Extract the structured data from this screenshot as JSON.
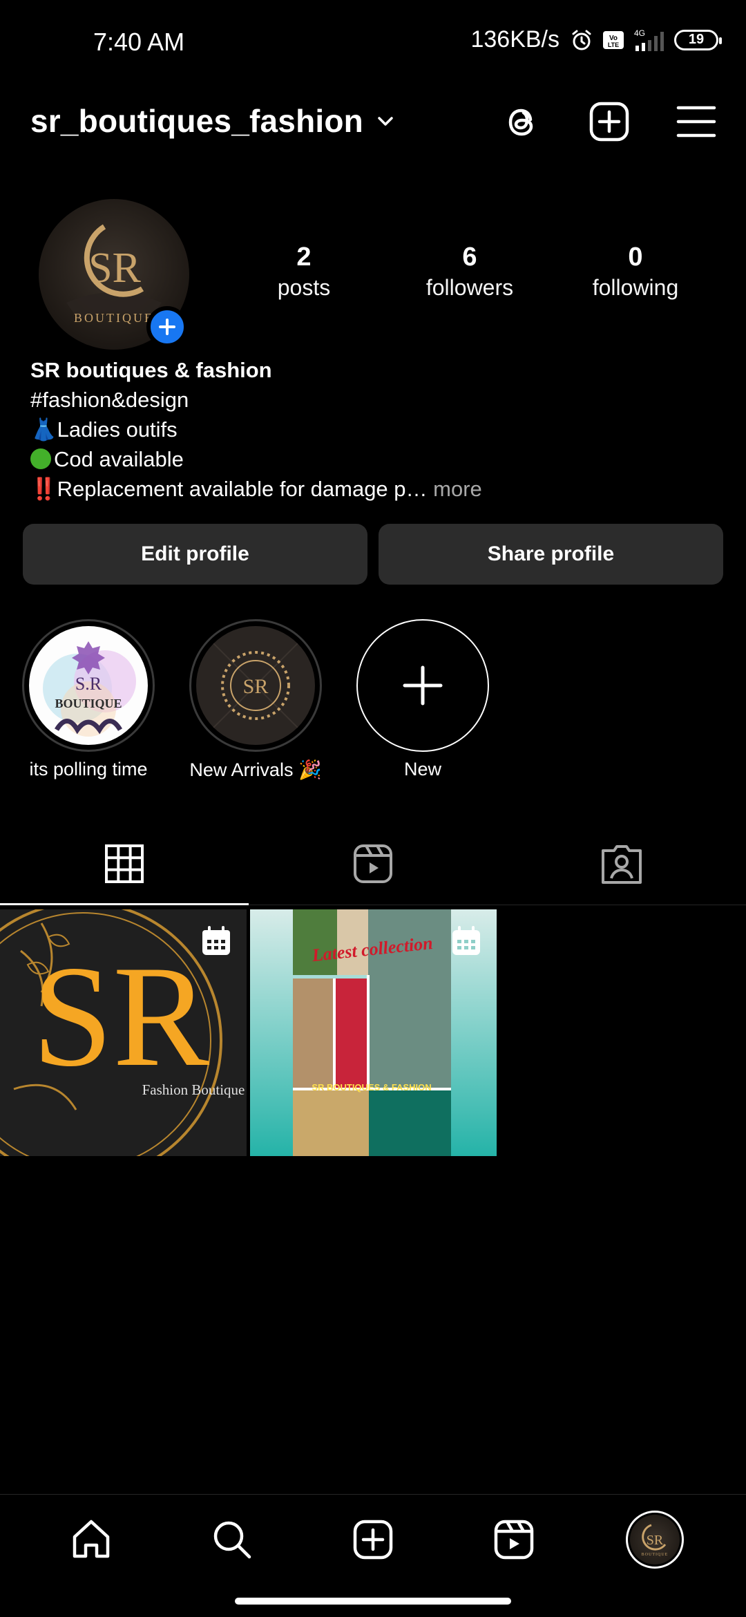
{
  "status_bar": {
    "time": "7:40 AM",
    "network_speed": "136KB/s",
    "network_type": "4G",
    "battery": "19",
    "icons": [
      "alarm-icon",
      "volte-icon",
      "signal-icon",
      "battery-icon"
    ]
  },
  "header": {
    "username": "sr_boutiques_fashion",
    "icons": [
      "chevron-down-icon",
      "threads-icon",
      "create-post-icon",
      "menu-icon"
    ]
  },
  "profile": {
    "avatar_text": "SR",
    "avatar_subtext": "BOUTIQUE",
    "stats": [
      {
        "value": "2",
        "label": "posts"
      },
      {
        "value": "6",
        "label": "followers"
      },
      {
        "value": "0",
        "label": "following"
      }
    ],
    "bio": {
      "name": "SR boutiques & fashion",
      "line1": "#fashion&design",
      "line2": "Ladies outifs",
      "line3": "Cod available",
      "line4": "Replacement available for damage p…",
      "more": "more",
      "emoji_dress": "👗",
      "emoji_alert": "‼️"
    }
  },
  "buttons": {
    "edit": "Edit profile",
    "share": "Share profile"
  },
  "highlights": [
    {
      "label": "its polling time",
      "image_text": "S.R",
      "image_subtext": "BOUTIQUE"
    },
    {
      "label": "New Arrivals 🎉",
      "image_text": "SR"
    },
    {
      "label": "New"
    }
  ],
  "tabs": [
    "grid-icon",
    "reels-icon",
    "tagged-icon"
  ],
  "posts": [
    {
      "title": "SR",
      "subtitle": "Fashion Boutique",
      "accent": "#f5a623"
    },
    {
      "title": "Latest collection",
      "subtitle": "SR BOUTIQUES & FASHION",
      "accent": "#2bb5ad"
    }
  ],
  "bottom_nav": [
    "home-icon",
    "search-icon",
    "create-icon",
    "reels-icon",
    "profile-avatar"
  ],
  "colors": {
    "background": "#000000",
    "button_bg": "#2c2c2c",
    "accent_blue": "#1877f2",
    "muted_text": "#a8a8a8",
    "gold": "#c9a36a"
  }
}
